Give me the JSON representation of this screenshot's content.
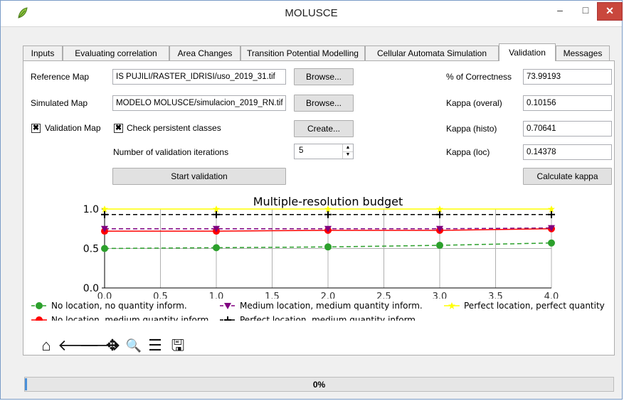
{
  "window": {
    "title": "MOLUSCE",
    "minimize": "–",
    "maximize": "□",
    "close": "✕"
  },
  "tabs": [
    {
      "label": "Inputs"
    },
    {
      "label": "Evaluating correlation"
    },
    {
      "label": "Area Changes"
    },
    {
      "label": "Transition Potential Modelling"
    },
    {
      "label": "Cellular Automata Simulation"
    },
    {
      "label": "Validation",
      "active": true
    },
    {
      "label": "Messages"
    }
  ],
  "validation": {
    "reference_map_label": "Reference Map",
    "reference_map_value": "IS PUJILI/RASTER_IDRISI/uso_2019_31.tif",
    "simulated_map_label": "Simulated Map",
    "simulated_map_value": "MODELO MOLUSCE/simulacion_2019_RN.tif",
    "browse_label": "Browse...",
    "validation_map_label": "Validation Map",
    "validation_map_checked": true,
    "persistent_label": "Check persistent classes",
    "persistent_checked": true,
    "create_label": "Create...",
    "iterations_label": "Number of validation iterations",
    "iterations_value": "5",
    "start_label": "Start validation",
    "correctness_label": "% of Correctness",
    "correctness_value": "73.99193",
    "kappa_overal_label": "Kappa (overal)",
    "kappa_overal_value": "0.10156",
    "kappa_histo_label": "Kappa (histo)",
    "kappa_histo_value": "0.70641",
    "kappa_loc_label": "Kappa (loc)",
    "kappa_loc_value": "0.14378",
    "calc_kappa_label": "Calculate kappa",
    "checkmark": "✖"
  },
  "chart_data": {
    "type": "line",
    "title": "Multiple-resolution budget",
    "xlim": [
      0,
      4
    ],
    "ylim": [
      0,
      1
    ],
    "x_ticks": [
      "0.0",
      "0.5",
      "1.0",
      "1.5",
      "2.0",
      "2.5",
      "3.0",
      "3.5",
      "4.0"
    ],
    "y_ticks": [
      "0.0",
      "0.5",
      "1.0"
    ],
    "grid": true,
    "legend_position": "bottom",
    "x": [
      0,
      1,
      2,
      3,
      4
    ],
    "series": [
      {
        "name": "No location, no quantity inform.",
        "values": [
          0.5,
          0.51,
          0.52,
          0.54,
          0.57
        ],
        "color": "#2ca02c",
        "dash": "6,4",
        "marker": "circle"
      },
      {
        "name": "No location, medium quantity inform.",
        "values": [
          0.72,
          0.72,
          0.73,
          0.73,
          0.75
        ],
        "color": "#ff0000",
        "dash": "",
        "marker": "circle"
      },
      {
        "name": "Medium location, medium quantity inform.",
        "values": [
          0.75,
          0.75,
          0.75,
          0.75,
          0.76
        ],
        "color": "#800080",
        "dash": "6,4",
        "marker": "triangle"
      },
      {
        "name": "Perfect location, medium quantity inform.",
        "values": [
          0.93,
          0.93,
          0.93,
          0.93,
          0.93
        ],
        "color": "#000000",
        "dash": "6,4",
        "marker": "plus"
      },
      {
        "name": "Perfect location, perfect quantity",
        "values": [
          1.0,
          1.0,
          1.0,
          1.0,
          1.0
        ],
        "color": "#ffff00",
        "dash": "",
        "marker": "star"
      }
    ]
  },
  "toolbar": {
    "home": "⌂",
    "back": "🡐",
    "forward": "🡒",
    "pan": "✥",
    "zoom": "🔍",
    "configure": "☰",
    "save": "🖫"
  },
  "progress": {
    "text": "0%",
    "value": 0
  }
}
